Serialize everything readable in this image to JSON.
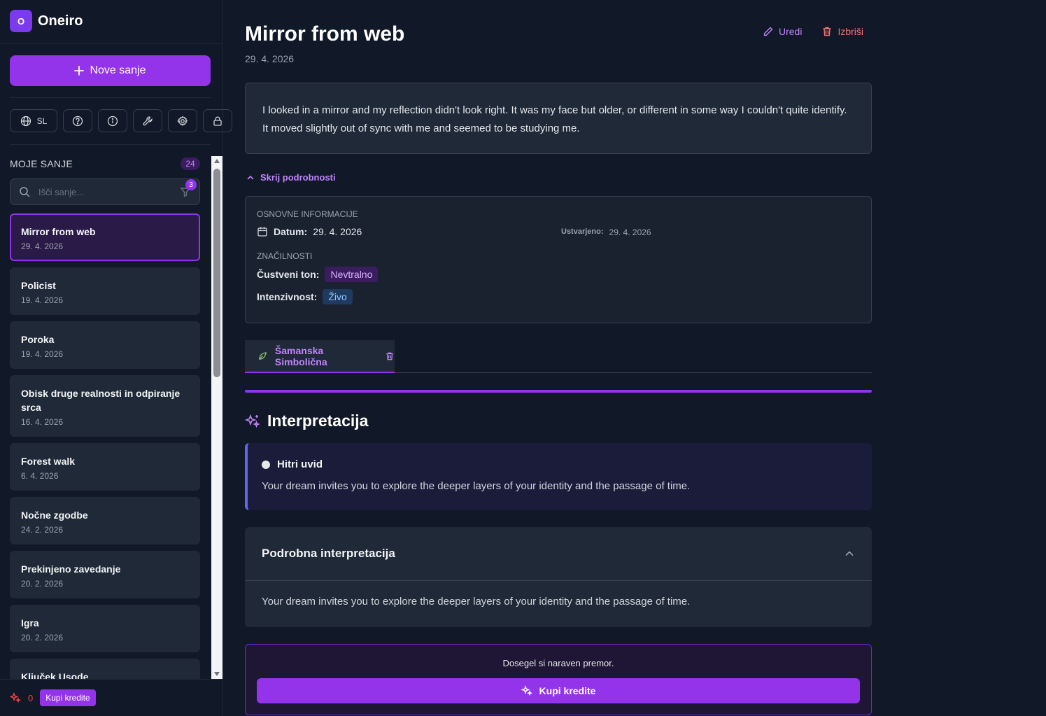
{
  "app": {
    "logo_letter": "O",
    "name": "Oneiro"
  },
  "sidebar": {
    "new_dream_label": "Nove sanje",
    "language_label": "SL",
    "tools": [
      "globe-icon",
      "help-icon",
      "info-icon",
      "wrench-icon",
      "gear-icon",
      "lock-icon"
    ],
    "section_title": "MOJE SANJE",
    "dream_count": "24",
    "search_placeholder": "Išči sanje...",
    "filter_count": "3",
    "dreams": [
      {
        "title": "Mirror from web",
        "date": "29. 4. 2026",
        "active": true
      },
      {
        "title": "Policist",
        "date": "19. 4. 2026"
      },
      {
        "title": "Poroka",
        "date": "19. 4. 2026"
      },
      {
        "title": "Obisk druge realnosti in odpiranje srca",
        "date": "16. 4. 2026"
      },
      {
        "title": "Forest walk",
        "date": "6. 4. 2026"
      },
      {
        "title": "Nočne zgodbe",
        "date": "24. 2. 2026"
      },
      {
        "title": "Prekinjeno zavedanje",
        "date": "20. 2. 2026"
      },
      {
        "title": "Igra",
        "date": "20. 2. 2026"
      },
      {
        "title": "Ključek Usode",
        "date": ""
      }
    ],
    "credits": "0",
    "buy_credits_label": "Kupi kredite"
  },
  "dream": {
    "title": "Mirror from web",
    "date": "29. 4. 2026",
    "edit_label": "Uredi",
    "delete_label": "Izbriši",
    "description": "I looked in a mirror and my reflection didn't look right. It was my face but older, or different in some way I couldn't quite identify. It moved slightly out of sync with me and seemed to be studying me.",
    "toggle_details_label": "Skrij podrobnosti",
    "info": {
      "basic_title": "OSNOVNE INFORMACIJE",
      "date_key": "Datum:",
      "date_value": "29. 4. 2026",
      "created_key": "Ustvarjeno:",
      "created_value": "29. 4. 2026",
      "features_title": "ZNAČILNOSTI",
      "tone_key": "Čustveni ton:",
      "tone_value": "Nevtralno",
      "intensity_key": "Intenzivnost:",
      "intensity_value": "Živo"
    },
    "tab_label": "Šamanska Simbolična"
  },
  "interpretation": {
    "title": "Interpretacija",
    "quick_title": "Hitri uvid",
    "quick_text": "Your dream invites you to explore the deeper layers of your identity and the passage of time.",
    "detail_title": "Podrobna interpretacija",
    "detail_text": "Your dream invites you to explore the deeper layers of your identity and the passage of time."
  },
  "limit": {
    "message": "Dosegel si naraven premor.",
    "buy_label": "Kupi kredite"
  },
  "colors": {
    "accent": "#9333ea",
    "danger": "#f87171",
    "background": "#111827"
  }
}
